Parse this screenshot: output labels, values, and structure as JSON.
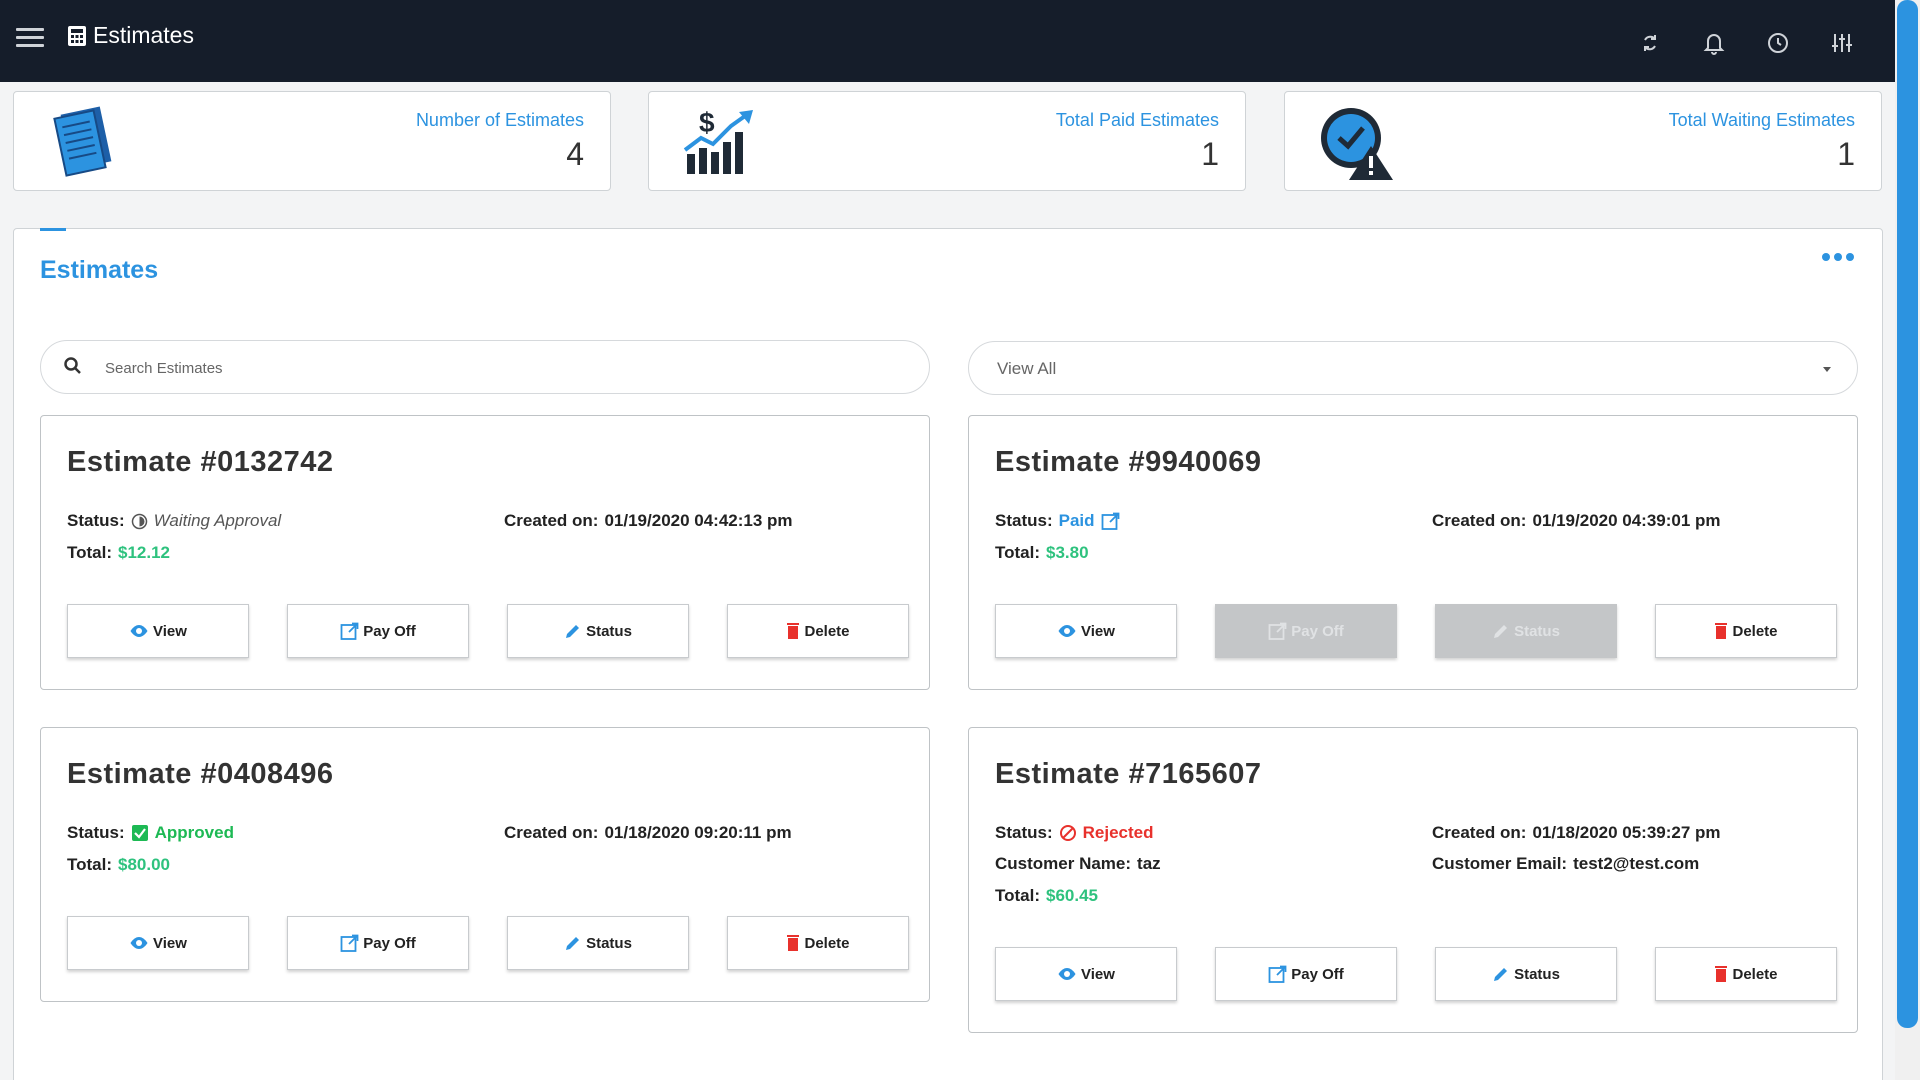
{
  "header": {
    "title": "Estimates"
  },
  "stats": [
    {
      "label": "Number of Estimates",
      "value": "4"
    },
    {
      "label": "Total Paid Estimates",
      "value": "1"
    },
    {
      "label": "Total Waiting Estimates",
      "value": "1"
    }
  ],
  "panel": {
    "title": "Estimates",
    "search_placeholder": "Search Estimates",
    "filter_value": "View All"
  },
  "labels": {
    "status": "Status:",
    "total": "Total:",
    "created": "Created on:",
    "customer_name": "Customer Name:",
    "customer_email": "Customer Email:"
  },
  "buttons": {
    "view": "View",
    "pay_off": "Pay Off",
    "status": "Status",
    "delete": "Delete"
  },
  "estimates": [
    {
      "title": "Estimate #0132742",
      "status": "Waiting Approval",
      "created": "01/19/2020 04:42:13 pm",
      "total": "$12.12"
    },
    {
      "title": "Estimate #9940069",
      "status": "Paid",
      "created": "01/19/2020 04:39:01 pm",
      "total": "$3.80"
    },
    {
      "title": "Estimate #0408496",
      "status": "Approved",
      "created": "01/18/2020 09:20:11 pm",
      "total": "$80.00"
    },
    {
      "title": "Estimate #7165607",
      "status": "Rejected",
      "created": "01/18/2020 05:39:27 pm",
      "total": "$60.45",
      "customer_name": "taz",
      "customer_email": "test2@test.com"
    }
  ],
  "colors": {
    "accent": "#2c93e0",
    "topbar": "#151d2a",
    "money": "#2ec27e",
    "approved": "#1db954",
    "rejected": "#e8312c",
    "delete": "#e8312c"
  },
  "icons": [
    "menu-icon",
    "calculator-icon",
    "refresh-icon",
    "bell-icon",
    "clock-icon",
    "sliders-icon",
    "documents-icon",
    "chart-dollar-icon",
    "clock-warning-icon",
    "search-icon",
    "eye-icon",
    "external-link-icon",
    "pencil-icon",
    "trash-icon"
  ]
}
